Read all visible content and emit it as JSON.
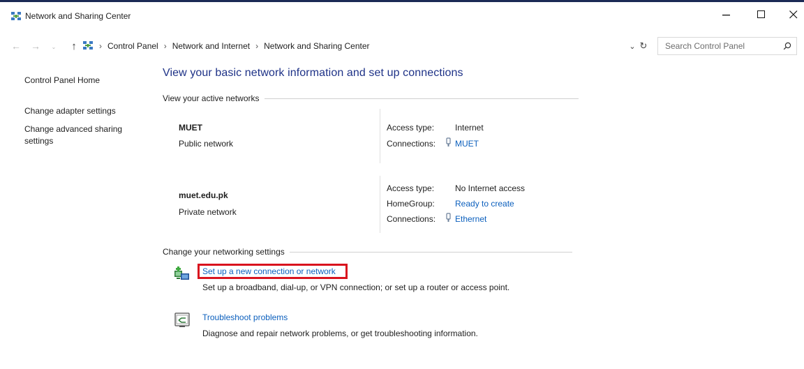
{
  "window": {
    "title": "Network and Sharing Center",
    "icon": "network-and-sharing-icon"
  },
  "navigation": {
    "breadcrumbs": [
      "Control Panel",
      "Network and Internet",
      "Network and Sharing Center"
    ],
    "search_placeholder": "Search Control Panel"
  },
  "sidebar": {
    "home": "Control Panel Home",
    "items": [
      "Change adapter settings",
      "Change advanced sharing settings"
    ]
  },
  "main": {
    "title": "View your basic network information and set up connections",
    "active_networks_heading": "View your active networks",
    "networks": [
      {
        "name": "MUET",
        "type": "Public network",
        "access_type_label": "Access type:",
        "access_type": "Internet",
        "connections_label": "Connections:",
        "connection": "MUET"
      },
      {
        "name": "muet.edu.pk",
        "type": "Private network",
        "access_type_label": "Access type:",
        "access_type": "No Internet access",
        "homegroup_label": "HomeGroup:",
        "homegroup": "Ready to create",
        "connections_label": "Connections:",
        "connection": "Ethernet"
      }
    ],
    "settings_heading": "Change your networking settings",
    "tasks": [
      {
        "link": "Set up a new connection or network",
        "description": "Set up a broadband, dial-up, or VPN connection; or set up a router or access point.",
        "icon": "new-connection-icon",
        "highlighted": true,
        "highlight_color": "#d9131e"
      },
      {
        "link": "Troubleshoot problems",
        "description": "Diagnose and repair network problems, or get troubleshooting information.",
        "icon": "troubleshoot-icon",
        "highlighted": false
      }
    ]
  },
  "colors": {
    "title_text": "#1e3287",
    "link": "#0b5fbd",
    "window_top_border": "#1b2a55"
  }
}
